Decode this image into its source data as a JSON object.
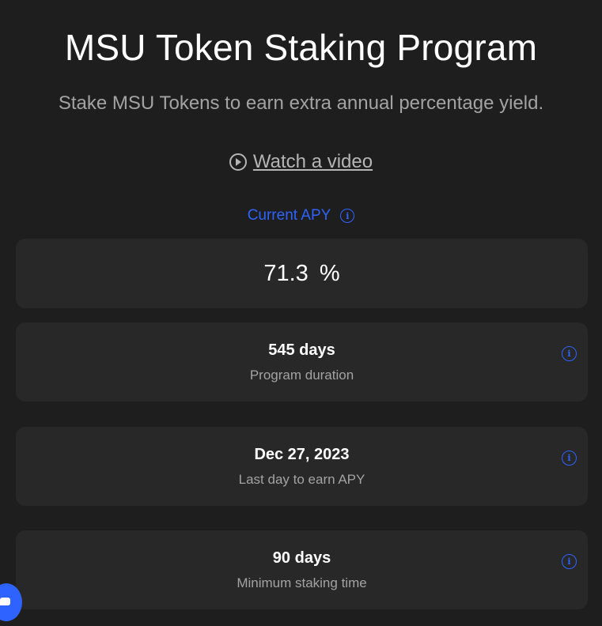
{
  "header": {
    "title": "MSU Token Staking Program",
    "subtitle": "Stake MSU Tokens to earn extra annual percentage yield.",
    "video_link": "Watch a video"
  },
  "apy": {
    "label": "Current APY",
    "value": "71.3  %"
  },
  "stats": [
    {
      "value": "545 days",
      "label": "Program duration"
    },
    {
      "value": "Dec 27, 2023",
      "label": "Last day to earn APY"
    },
    {
      "value": "90 days",
      "label": "Minimum staking time"
    }
  ],
  "icons": {
    "info": "i",
    "play": "play-circle-icon",
    "chat": "chat-icon"
  },
  "colors": {
    "background": "#1e1e1e",
    "card": "#282828",
    "accent": "#2f63ff",
    "muted_text": "#a3a3a3"
  }
}
